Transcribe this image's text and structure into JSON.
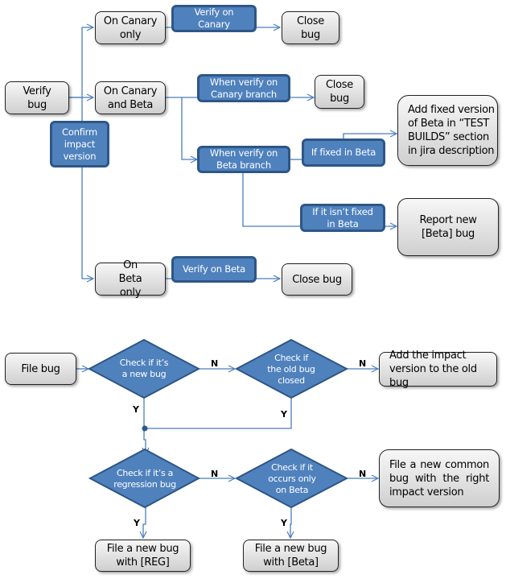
{
  "colors": {
    "blue_fill": "#4f81bd",
    "blue_border": "#2e5686",
    "connector": "#4a7ebb",
    "grey_fill_top": "#f7f7f7",
    "grey_fill_bottom": "#cfcfcf"
  },
  "top_flow": {
    "verify_bug": "Verify bug",
    "confirm_impact": "Confirm impact version",
    "on_canary_only": "On Canary only",
    "verify_on_canary": "Verify on Canary",
    "close_bug_1": "Close bug",
    "on_canary_and_beta": "On Canary and Beta",
    "when_verify_canary_branch": "When verify on Canary branch",
    "close_bug_2": "Close bug",
    "when_verify_beta_branch": "When verify on Beta branch",
    "if_fixed_in_beta": "If fixed in Beta",
    "add_fixed_version": "Add fixed version of Beta in “TEST BUILDS” section in jira description",
    "if_not_fixed_in_beta": "If it isn’t fixed in Beta",
    "report_new_beta_bug": "Report new [Beta] bug",
    "on_beta_only": "On Beta only",
    "verify_on_beta": "Verify on Beta",
    "close_bug_3": "Close bug"
  },
  "bottom_flow": {
    "file_bug": "File bug",
    "check_new_bug": "Check if it’s a new bug",
    "check_old_closed": "Check if the old bug closed",
    "add_impact_old": "Add the impact version to the old bug",
    "check_regression": "Check if it’s a regression bug",
    "check_only_beta": "Check if it occurs only on Beta",
    "file_common_bug": "File a new common bug with the right impact version",
    "file_reg_bug": "File a new bug with [REG]",
    "file_beta_bug": "File a new bug with [Beta]",
    "label_n": "N",
    "label_y": "Y"
  }
}
